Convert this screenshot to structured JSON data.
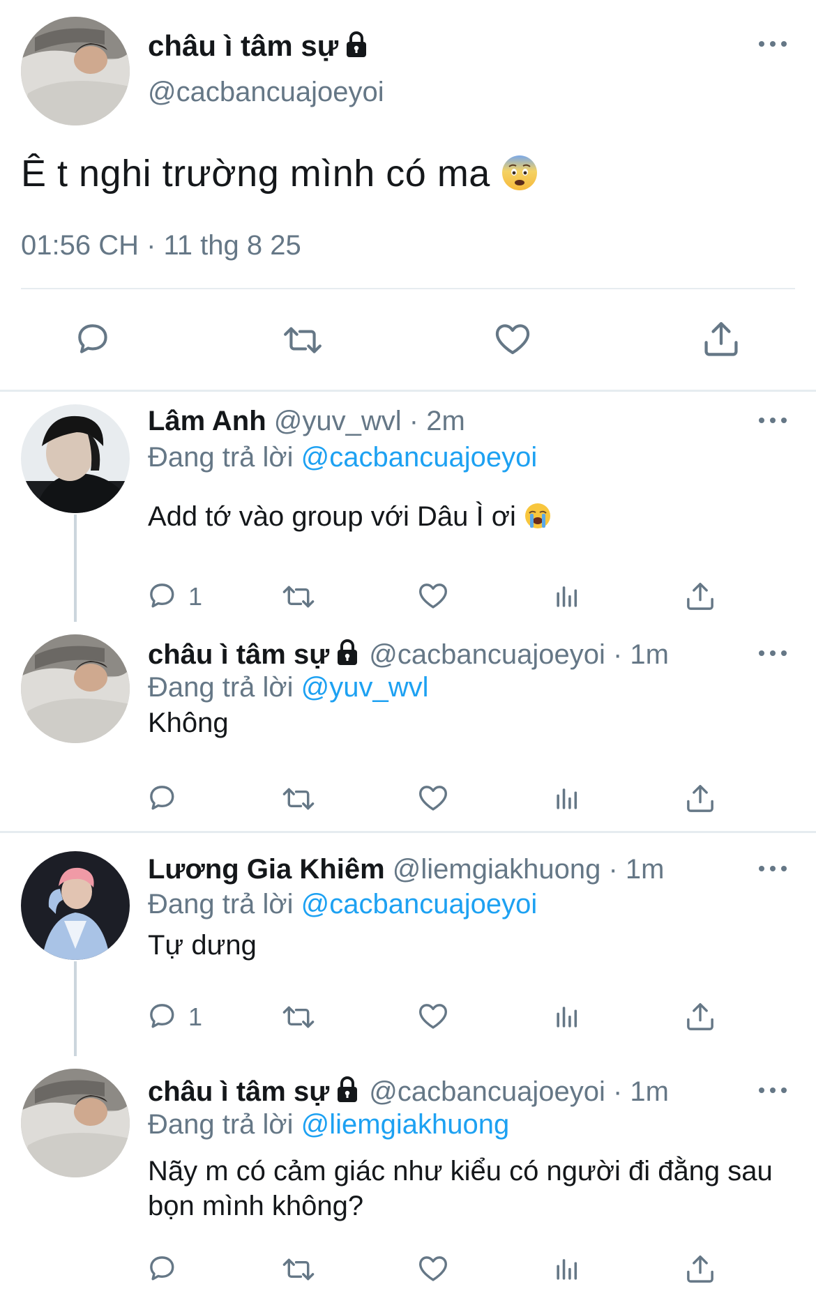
{
  "main_tweet": {
    "author_name": "châu ì tâm sự",
    "author_handle": "@cacbancuajoeyoi",
    "text": "Ê t nghi trường mình có ma",
    "text_emoji": "fearful-face-emoji",
    "timestamp": "01:56 CH · 11 thg 8 25",
    "actions": [
      "reply-icon",
      "retweet-icon",
      "like-icon",
      "share-icon"
    ]
  },
  "replies": [
    {
      "name": "Lâm Anh",
      "handle": "@yuv_wvl",
      "time": "· 2m",
      "replying_prefix": "Đang trả lời",
      "replying_to": "@cacbancuajoeyoi",
      "text": "Add tớ vào group với Dâu Ì ơi",
      "text_emoji": "loudly-crying-face-emoji",
      "reply_count": "1"
    },
    {
      "name": "châu ì tâm sự",
      "handle": "@cacbancuajoeyoi",
      "time": "· 1m",
      "replying_prefix": "Đang trả lời",
      "replying_to": "@yuv_wvl",
      "text": "Không",
      "reply_count": ""
    },
    {
      "name": "Lương Gia Khiêm",
      "handle": "@liemgiakhuong",
      "time": "· 1m",
      "replying_prefix": "Đang trả lời",
      "replying_to": "@cacbancuajoeyoi",
      "text": "Tự dưng",
      "reply_count": "1"
    },
    {
      "name": "châu ì tâm sự",
      "handle": "@cacbancuajoeyoi",
      "time": "· 1m",
      "replying_prefix": "Đang trả lời",
      "replying_to": "@liemgiakhuong",
      "text": "Nãy m có cảm giác như kiểu có người đi đằng sau bọn mình không?",
      "reply_count": ""
    }
  ],
  "colors": {
    "text": "#14171a",
    "secondary": "#657786",
    "link": "#1da1f2",
    "divider": "#e6ecf0",
    "thread_line": "#ccd6dd"
  }
}
